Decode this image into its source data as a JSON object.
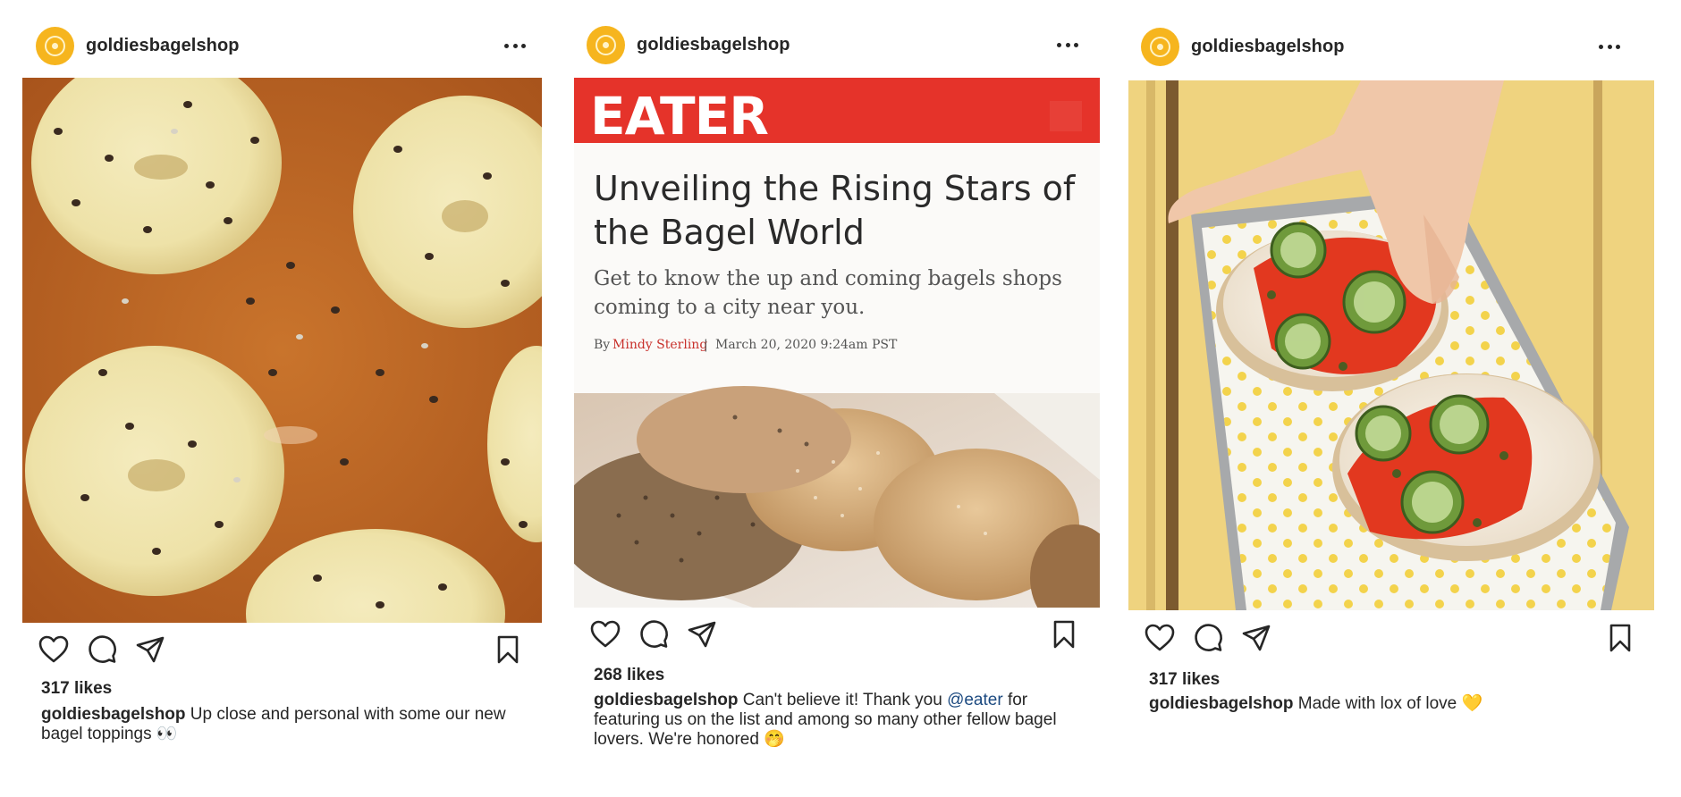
{
  "posts": [
    {
      "username": "goldiesbagelshop",
      "likes": "317 likes",
      "caption_user": "goldiesbagelshop",
      "caption_text": " Up close and personal with some our new bagel toppings 👀"
    },
    {
      "username": "goldiesbagelshop",
      "likes": "268 likes",
      "caption_user": "goldiesbagelshop",
      "caption_text_before": " Can't believe it! Thank you ",
      "caption_mention": "@eater",
      "caption_text_after": " for featuring us on the list and among so many other fellow bagel lovers. We're honored 🤭",
      "article": {
        "brand": "EATER",
        "headline_line1": "Unveiling the Rising Stars of",
        "headline_line2": "the Bagel World",
        "subhead_line1": "Get to know the up and coming bagels shops",
        "subhead_line2": "coming to a city near you.",
        "byline_prefix": "By",
        "author": "Mindy Sterling",
        "separator": "|",
        "date": "March 20, 2020 9:24am PST"
      }
    },
    {
      "username": "goldiesbagelshop",
      "likes": "317 likes",
      "caption_user": "goldiesbagelshop",
      "caption_text": " Made with lox of love 💛"
    }
  ],
  "colors": {
    "avatar": "#f6b51e",
    "eater_red": "#e5332a",
    "author_red": "#c8302b",
    "mention_blue": "#1c4a80",
    "text": "#262626"
  },
  "icons": [
    "heart-icon",
    "comment-icon",
    "share-icon",
    "bookmark-icon",
    "more-icon"
  ]
}
